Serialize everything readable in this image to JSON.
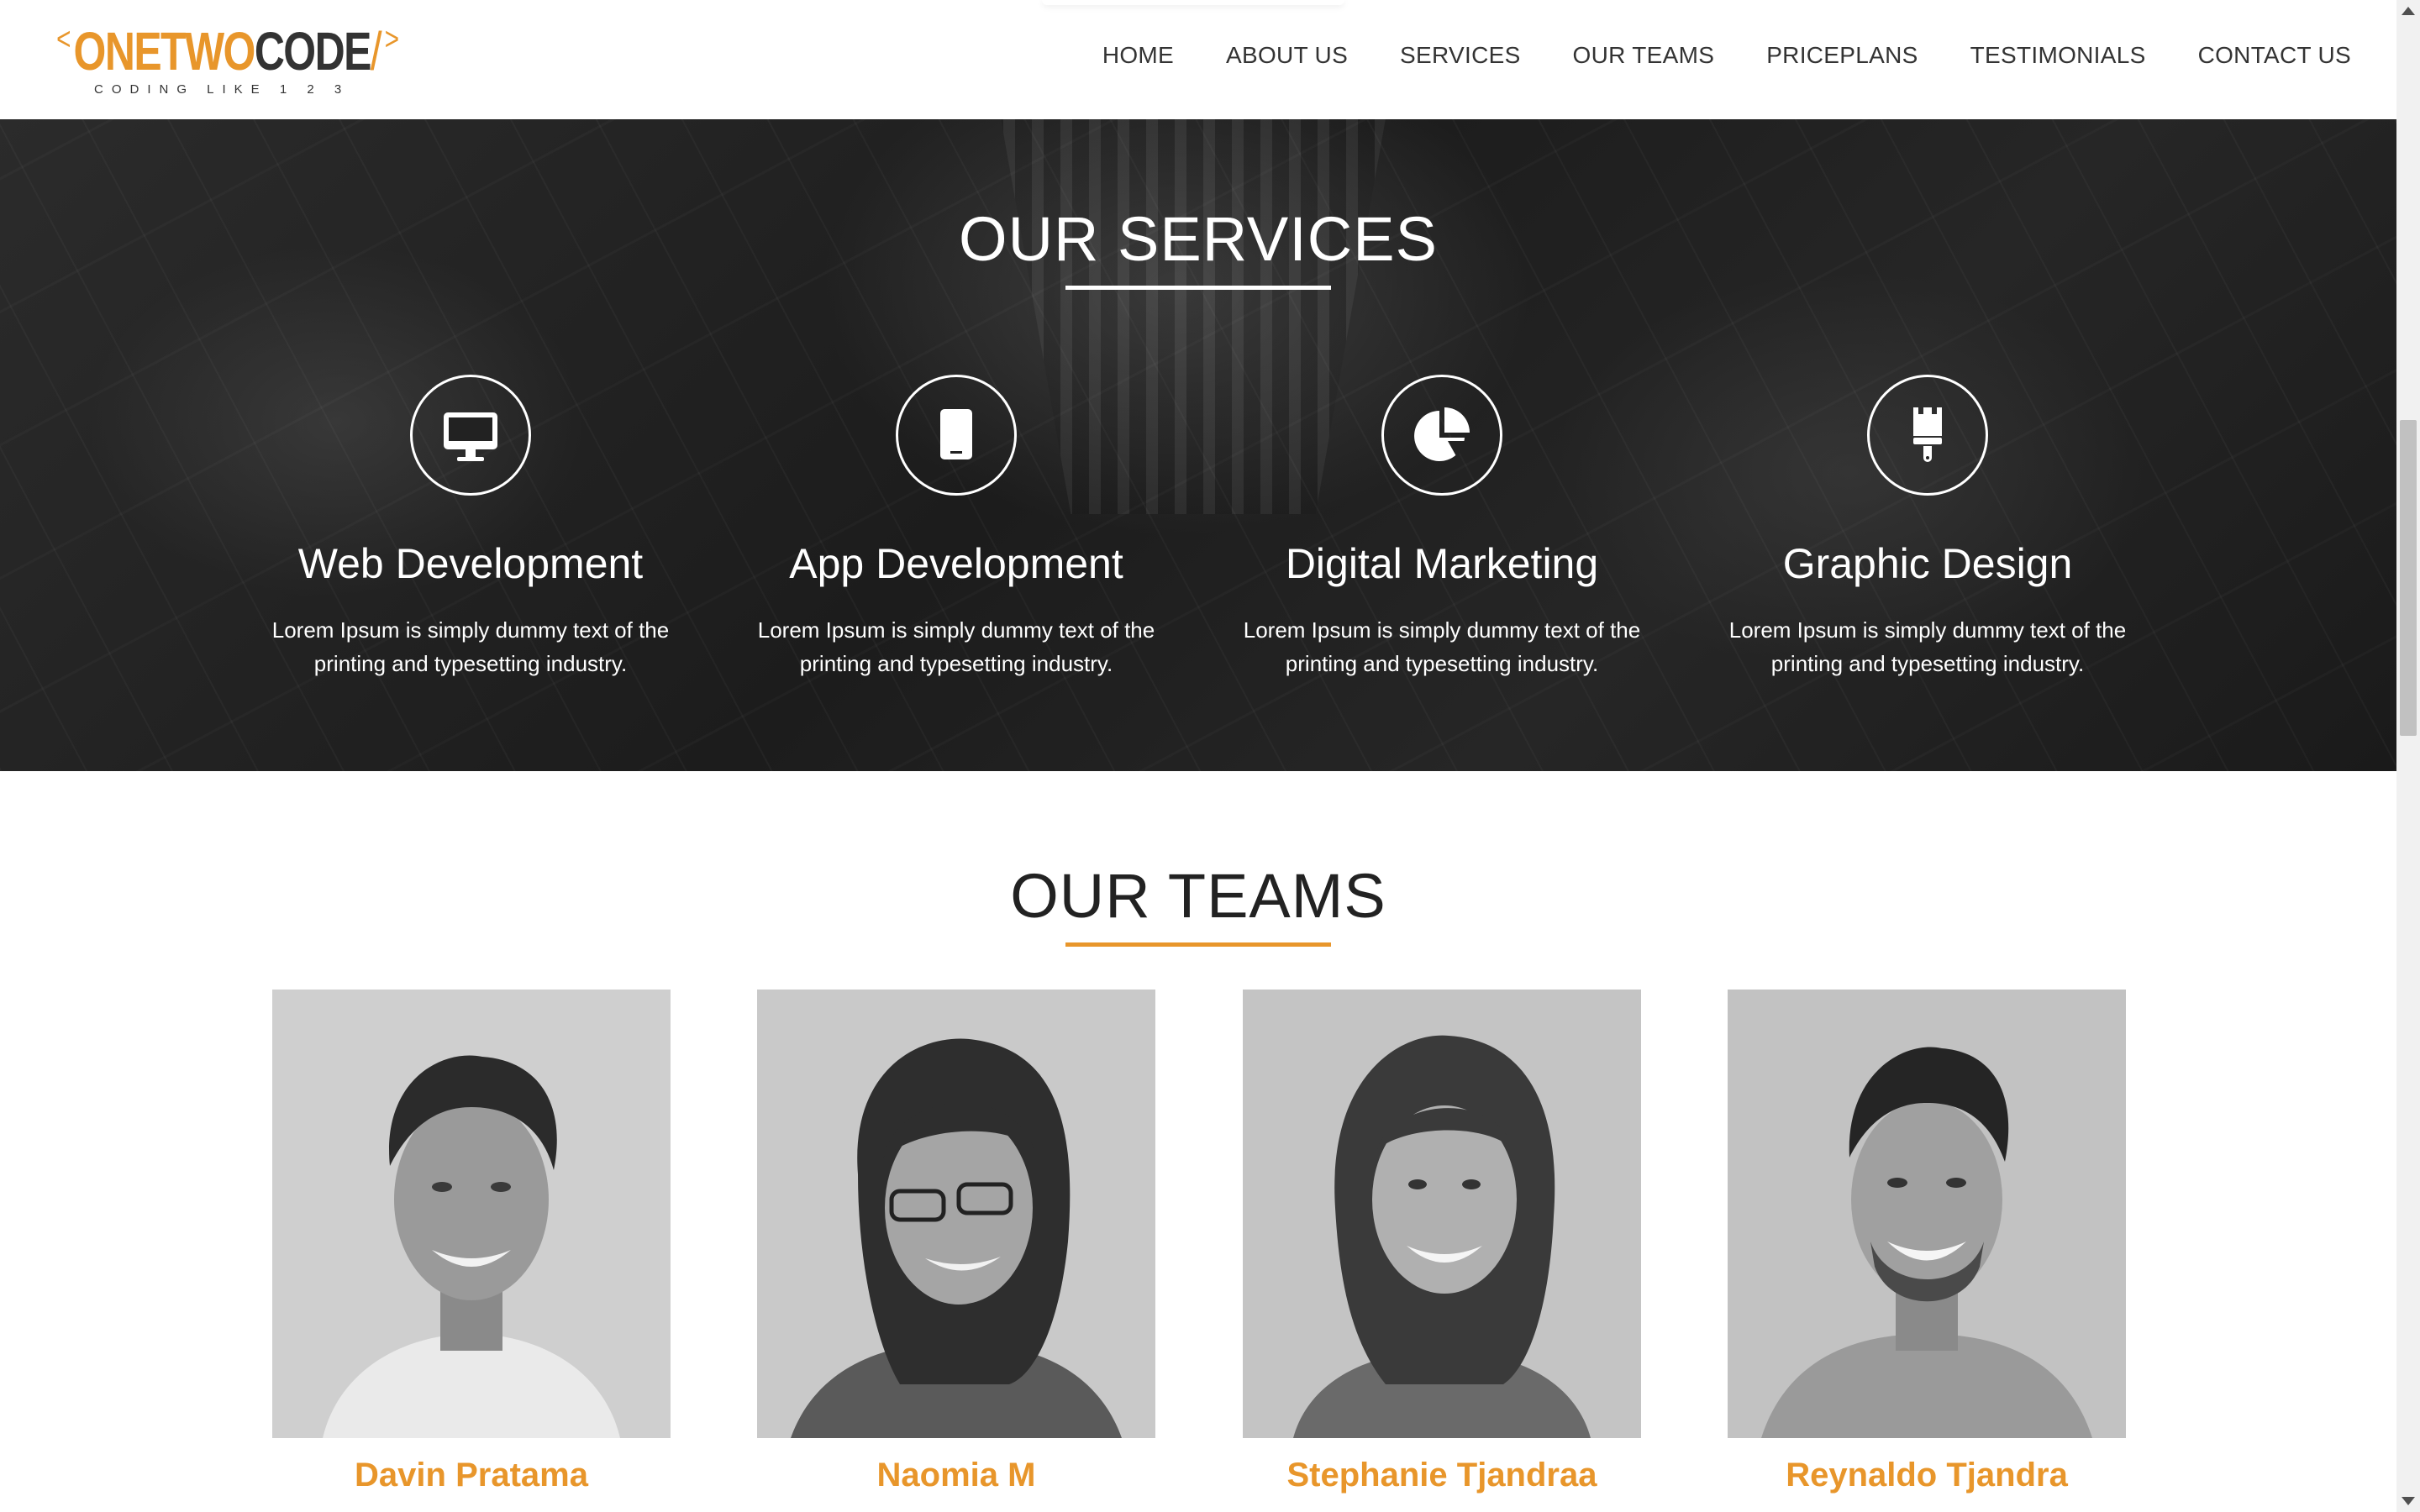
{
  "header": {
    "logo": {
      "bracket_left": "<",
      "word_one": "ONETWO",
      "word_two": "CODE",
      "slash": "/",
      "bracket_right": ">",
      "tagline": "CODING LIKE 1 2 3"
    },
    "nav": [
      {
        "label": "HOME"
      },
      {
        "label": "ABOUT US"
      },
      {
        "label": "SERVICES"
      },
      {
        "label": "OUR TEAMS"
      },
      {
        "label": "PRICEPLANS"
      },
      {
        "label": "TESTIMONIALS"
      },
      {
        "label": "CONTACT US"
      }
    ]
  },
  "services": {
    "title": "OUR SERVICES",
    "items": [
      {
        "icon": "monitor-icon",
        "title": "Web Development",
        "text": "Lorem Ipsum is simply dummy text of the printing and typesetting industry."
      },
      {
        "icon": "tablet-icon",
        "title": "App Development",
        "text": "Lorem Ipsum is simply dummy text of the printing and typesetting industry."
      },
      {
        "icon": "pie-chart-icon",
        "title": "Digital Marketing",
        "text": "Lorem Ipsum is simply dummy text of the printing and typesetting industry."
      },
      {
        "icon": "paint-brush-icon",
        "title": "Graphic Design",
        "text": "Lorem Ipsum is simply dummy text of the printing and typesetting industry."
      }
    ]
  },
  "teams": {
    "title": "OUR TEAMS",
    "members": [
      {
        "name": "Davin Pratama"
      },
      {
        "name": "Naomia M"
      },
      {
        "name": "Stephanie Tjandraa"
      },
      {
        "name": "Reynaldo Tjandra"
      }
    ]
  },
  "colors": {
    "accent": "#e8962b",
    "text_dark": "#333333",
    "services_bg": "#222222"
  }
}
